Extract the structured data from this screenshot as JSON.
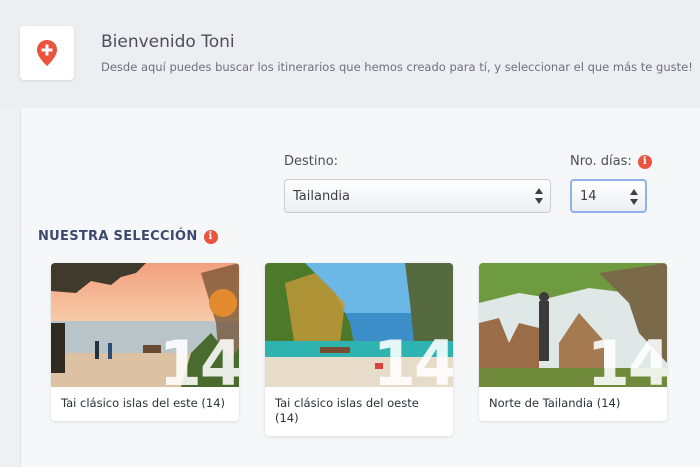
{
  "header": {
    "welcome": "Bienvenido Toni",
    "subtitle": "Desde aquí puedes buscar los itinerarios que hemos creado para tí, y seleccionar el que más te guste!"
  },
  "filters": {
    "destino_label": "Destino:",
    "destino_value": "Tailandia",
    "dias_label": "Nro. días:",
    "dias_value": "14"
  },
  "section": {
    "title": "NUESTRA SELECCIÓN"
  },
  "cards": [
    {
      "days": "14",
      "name": "Tai clásico islas del este (14)"
    },
    {
      "days": "14",
      "name": "Tai clásico islas del oeste (14)"
    },
    {
      "days": "14",
      "name": "Norte de Tailandia (14)"
    }
  ],
  "colors": {
    "accent": "#e8543e",
    "section_title": "#3d4a6e"
  },
  "icons": {
    "logo": "map-pin-plus-icon",
    "info": "info-icon"
  }
}
